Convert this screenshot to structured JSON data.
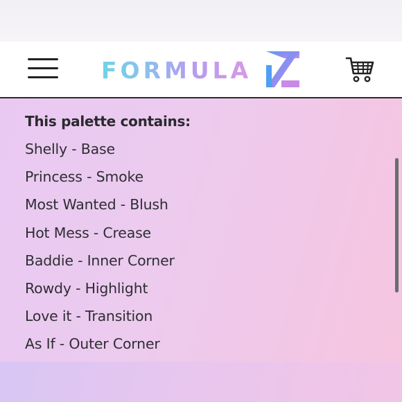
{
  "header": {
    "brand": "FORMULA",
    "brand_mark_icon": "formula-x-logo",
    "menu_icon": "hamburger-menu-icon",
    "cart_icon": "shopping-cart-icon"
  },
  "palette": {
    "heading": "This palette contains:",
    "items": [
      "Shelly - Base",
      "Princess - Smoke",
      "Most Wanted - Blush",
      "Hot Mess - Crease",
      "Baddie - Inner Corner",
      "Rowdy - Highlight",
      "Love it - Transition",
      "As If - Outer Corner"
    ]
  },
  "colors": {
    "brand_gradient_start": "#6fd3e6",
    "brand_gradient_end": "#d89ae6",
    "mark_blue": "#5aa8f0",
    "mark_violet": "#b08cf0",
    "background_pink": "#f2c7e6",
    "background_lavender": "#e9c9f2"
  }
}
